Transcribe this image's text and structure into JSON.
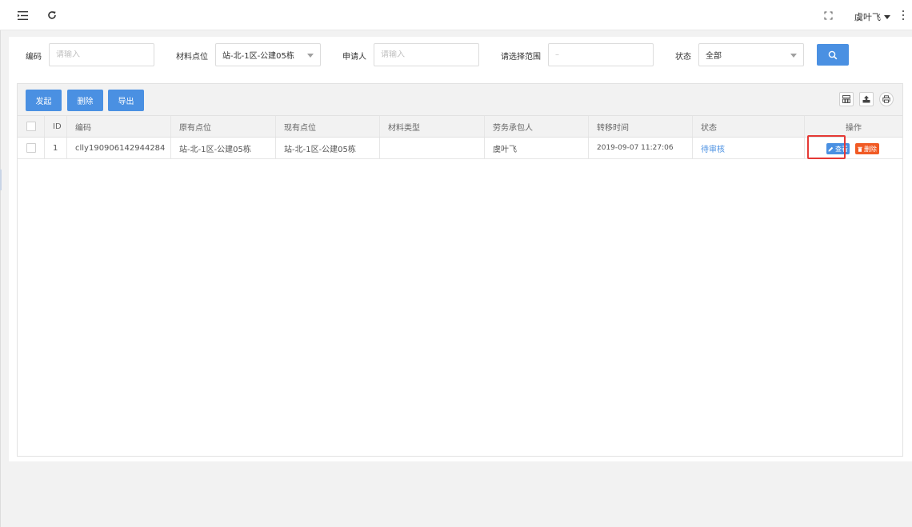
{
  "user": {
    "name": "虞叶飞"
  },
  "filters": {
    "code": {
      "label": "编码",
      "placeholder": "请输入"
    },
    "point": {
      "label": "材料点位",
      "value": "站-北-1区-公建05栋"
    },
    "applicant": {
      "label": "申请人",
      "placeholder": "请输入"
    },
    "range": {
      "label": "请选择范围",
      "placeholder": "–"
    },
    "status": {
      "label": "状态",
      "value": "全部"
    }
  },
  "toolbar": {
    "initiate": "发起",
    "delete": "删除",
    "export": "导出"
  },
  "table": {
    "columns": [
      "ID",
      "编码",
      "原有点位",
      "现有点位",
      "材料类型",
      "劳务承包人",
      "转移时间",
      "状态",
      "操作"
    ],
    "rows": [
      {
        "id": "1",
        "code": "clly190906142944284",
        "orig_point": "站-北-1区-公建05栋",
        "curr_point": "站-北-1区-公建05栋",
        "material_type": "",
        "contractor": "虞叶飞",
        "time": "2019-09-07 11:27:06",
        "status": "待审核",
        "view": "查看",
        "delete": "删除"
      }
    ]
  },
  "colors": {
    "primary": "#4a90e2",
    "danger": "#f15a24",
    "highlight": "#e53935"
  }
}
